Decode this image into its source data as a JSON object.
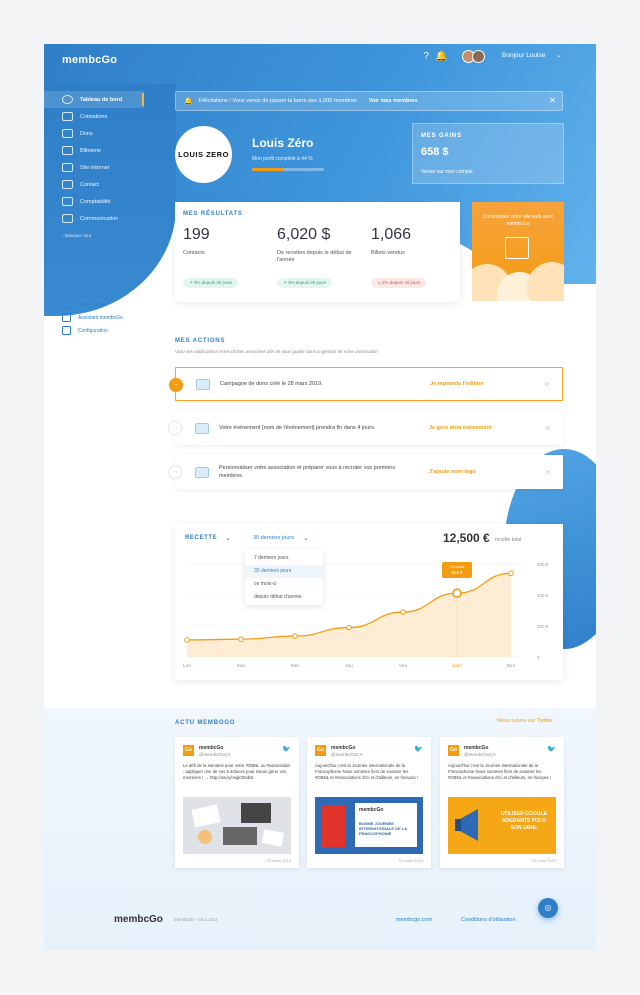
{
  "app": {
    "logo": "membcGo"
  },
  "header": {
    "greeting": "Bonjour Louise"
  },
  "sidebar": {
    "items": [
      {
        "label": "Tableau de bord",
        "active": true
      },
      {
        "label": "Cotisations"
      },
      {
        "label": "Dons"
      },
      {
        "label": "Billeterie"
      },
      {
        "label": "Site internet"
      },
      {
        "label": "Contact"
      },
      {
        "label": "Comptabilité"
      },
      {
        "label": "Communication"
      }
    ],
    "hide": "Masquer tout",
    "help": [
      {
        "label": "Aide en ligne"
      },
      {
        "label": "Assistant membcGo"
      },
      {
        "label": "Configuration"
      }
    ]
  },
  "notification": {
    "text": "Félicitations ! Vous venez de passer la barre des 1,000 membres",
    "link": "Voir mes membres"
  },
  "profile": {
    "logo_text": "LOUIS ZERO",
    "name": "Louis Zéro",
    "completion": "Mon profil complété à 44 %",
    "completion_value": 0.44
  },
  "gains": {
    "title": "MES GAINS",
    "value": "658 $",
    "link": "Verser sur mon compte"
  },
  "results": {
    "title": "MES RÉSULTATS",
    "stats": [
      {
        "value": "199",
        "label": "Contacts",
        "badge": "3% depuis 30 jours",
        "trend": "up"
      },
      {
        "value": "6,020 $",
        "label": "De recettes depuis le début de l'année",
        "badge": "3% depuis 30 jours",
        "trend": "up"
      },
      {
        "value": "1,066",
        "label": "Billets vendus",
        "badge": "2% depuis 30 jours",
        "trend": "down"
      }
    ]
  },
  "promo": {
    "text": "Construisez votre site web avec membcGo"
  },
  "actions": {
    "title": "MES ACTIONS",
    "subtitle": "Voici vos notifications et les tâches associées afin de vous guider dans la gestion de votre association",
    "items": [
      {
        "text": "Campagne de dons créé le 28 mars 2019.",
        "cta": "Je reprends l'édition"
      },
      {
        "text": "Votre événement [nom de l'événement] prendra fin dans 4 jours.",
        "cta": "Je gère mon événement"
      },
      {
        "text": "Personnaliser votre association et préparer vous à recruter vos premiers membres.",
        "cta": "J'ajoute mon logo"
      }
    ]
  },
  "revenue": {
    "title": "RECETTE",
    "range": "30 derniers jours",
    "total": "12,500 €",
    "total_label": "recette total",
    "dropdown": [
      "7 derniers jours",
      "30 derniers jours",
      "ce mois-ci",
      "depuis début d'année"
    ],
    "tooltip_date": "30 mars",
    "tooltip_value": "412 €"
  },
  "chart_data": {
    "type": "line",
    "categories": [
      "Lun",
      "Mar",
      "Mer",
      "Jeu",
      "Ven",
      "Sam",
      "Dim"
    ],
    "values": [
      110,
      115,
      135,
      190,
      290,
      412,
      540
    ],
    "y_ticks": [
      "600 €",
      "400 €",
      "200 €",
      "0"
    ],
    "ylim": [
      0,
      600
    ],
    "highlight_index": 5,
    "color": "#f39c12"
  },
  "news": {
    "title": "ACTU MEMBOGO",
    "follow": "Nous suivre sur Twitter",
    "tweets": [
      {
        "name": "membcGo",
        "handle": "@membcGoCA",
        "text": "Le défi de la semaine pour votre #OBNL ou #association : appliquer une de ces 6 astuces pour mieux gérer vos membres ! → http://ow.ly/nsgk30ob3i",
        "date": "25 mars 2019"
      },
      {
        "name": "membcGo",
        "handle": "@membcGoCA",
        "text": "Aujourd'hui c'est la Journée internationale de la Francophonie Nous sommes fiers de soutenir les #OBNL et #associations d'ici et d'ailleurs, en français !",
        "date": "20 mars 2019",
        "image_text": "BONNE JOURNÉE INTERNATIONALE DE LA FRANCOPHONIE"
      },
      {
        "name": "membcGo",
        "handle": "@membcGoCA",
        "text": "Aujourd'hui c'est la Journée internationale de la Francophonie Nous sommes fiers de soutenir les #OBNL et #associations d'ici et d'ailleurs, en français !",
        "date": "20 mars 2019",
        "image_text": "UTILISER GOOGLE ADGRANTS POUR SON OBNL"
      }
    ]
  },
  "footer": {
    "logo": "membcGo",
    "version": "membcGo - v3.1.10.3",
    "links": [
      "membcgo.com",
      "Conditions d'utilisation"
    ]
  }
}
